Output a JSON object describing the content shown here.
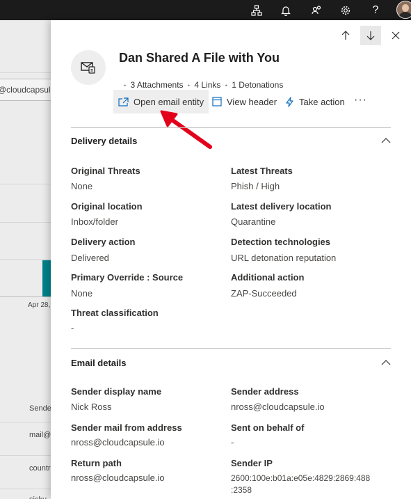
{
  "header": {
    "icons": [
      "org-chart-icon",
      "bell-icon",
      "people-icon",
      "gear-icon",
      "help-icon",
      "avatar"
    ],
    "help_glyph": "?"
  },
  "background": {
    "search_value": "@cloudcapsule",
    "date_tick": "Apr 28,",
    "col_header": "Sende",
    "rows": [
      "mail@",
      "countr",
      "sicku"
    ]
  },
  "panel": {
    "title": "Dan Shared A File with You",
    "meta": [
      "3 Attachments",
      "4 Links",
      "1 Detonations"
    ],
    "actions": {
      "open_email_entity": "Open email entity",
      "view_header": "View header",
      "take_action": "Take action",
      "more": "···"
    },
    "delivery": {
      "title": "Delivery details",
      "fields": [
        {
          "label": "Original Threats",
          "value": "None"
        },
        {
          "label": "Latest Threats",
          "value": "Phish / High"
        },
        {
          "label": "Original location",
          "value": "Inbox/folder"
        },
        {
          "label": "Latest delivery location",
          "value": "Quarantine"
        },
        {
          "label": "Delivery action",
          "value": "Delivered"
        },
        {
          "label": "Detection technologies",
          "value": "URL detonation reputation"
        },
        {
          "label": "Primary Override : Source",
          "value": "None"
        },
        {
          "label": "Additional action",
          "value": "ZAP-Succeeded"
        },
        {
          "label": "Threat classification",
          "value": "-"
        }
      ]
    },
    "email": {
      "title": "Email details",
      "fields": [
        {
          "label": "Sender display name",
          "value": "Nick Ross"
        },
        {
          "label": "Sender address",
          "value": "nross@cloudcapsule.io"
        },
        {
          "label": "Sender mail from address",
          "value": "nross@cloudcapsule.io"
        },
        {
          "label": "Sent on behalf of",
          "value": "-"
        },
        {
          "label": "Return path",
          "value": "nross@cloudcapsule.io"
        },
        {
          "label": "Sender IP",
          "value": "2600:100e:b01a:e05e:4829:2869:488",
          "value2": ":2358"
        }
      ]
    }
  },
  "colors": {
    "accent": "#0f6cbd",
    "annotation_arrow": "#e3001b",
    "teal_bar": "#00818a"
  }
}
